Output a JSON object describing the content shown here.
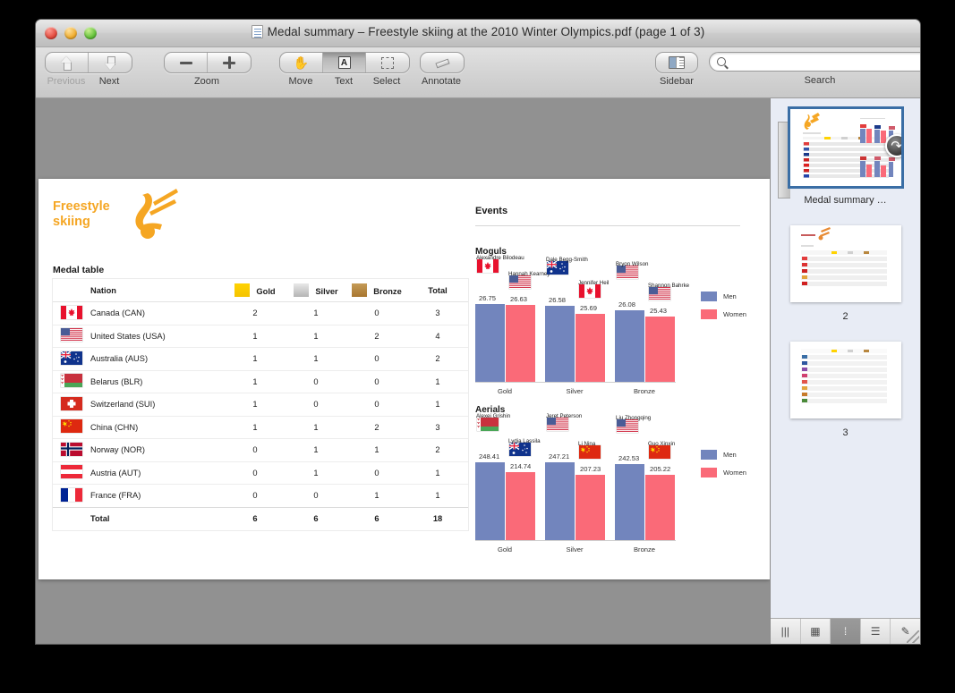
{
  "window": {
    "title": "Medal summary – Freestyle skiing at the 2010 Winter Olympics.pdf (page 1 of 3)",
    "doc_icon": "pdf-document-icon"
  },
  "toolbar": {
    "nav": {
      "previous": "Previous",
      "next": "Next"
    },
    "zoom": {
      "label": "Zoom",
      "out_icon": "zoom-out-icon",
      "in_icon": "zoom-in-icon"
    },
    "tools": {
      "move": "Move",
      "text": "Text",
      "select": "Select",
      "active": "Text"
    },
    "annotate": "Annotate",
    "sidebar": "Sidebar",
    "search": {
      "label": "Search",
      "value": "",
      "placeholder": ""
    }
  },
  "sidebar": {
    "thumbnails": [
      {
        "caption": "Medal summary …",
        "selected": true
      },
      {
        "caption": "2",
        "selected": false
      },
      {
        "caption": "3",
        "selected": false
      }
    ],
    "view_buttons": [
      "column-view-icon",
      "grid-view-icon",
      "thumbnail-view-icon",
      "outline-view-icon",
      "annotation-view-icon"
    ],
    "active_view": "thumbnail-view-icon"
  },
  "page": {
    "logo": {
      "line1": "Freestyle",
      "line2": "skiing",
      "color": "#f5a623"
    },
    "medal_table": {
      "title": "Medal table",
      "headers": [
        "",
        "Nation",
        "Gold",
        "Silver",
        "Bronze",
        "Total"
      ],
      "swatch_colors": {
        "gold": "#ffd301",
        "silver": "#d0d0d0",
        "bronze": "#b8873f"
      },
      "rows": [
        {
          "flag": "flag-canada",
          "nation": "Canada (CAN)",
          "gold": "2",
          "silver": "1",
          "bronze": "0",
          "total": "3"
        },
        {
          "flag": "flag-usa",
          "nation": "United States (USA)",
          "gold": "1",
          "silver": "1",
          "bronze": "2",
          "total": "4"
        },
        {
          "flag": "flag-australia",
          "nation": "Australia (AUS)",
          "gold": "1",
          "silver": "1",
          "bronze": "0",
          "total": "2"
        },
        {
          "flag": "flag-belarus",
          "nation": "Belarus (BLR)",
          "gold": "1",
          "silver": "0",
          "bronze": "0",
          "total": "1"
        },
        {
          "flag": "flag-switzerland",
          "nation": "Switzerland (SUI)",
          "gold": "1",
          "silver": "0",
          "bronze": "0",
          "total": "1"
        },
        {
          "flag": "flag-china",
          "nation": "China (CHN)",
          "gold": "1",
          "silver": "1",
          "bronze": "2",
          "total": "3"
        },
        {
          "flag": "flag-norway",
          "nation": "Norway (NOR)",
          "gold": "0",
          "silver": "1",
          "bronze": "1",
          "total": "2"
        },
        {
          "flag": "flag-austria",
          "nation": "Austria (AUT)",
          "gold": "0",
          "silver": "1",
          "bronze": "0",
          "total": "1"
        },
        {
          "flag": "flag-france",
          "nation": "France (FRA)",
          "gold": "0",
          "silver": "0",
          "bronze": "1",
          "total": "1"
        }
      ],
      "total_row": {
        "label": "Total",
        "gold": "6",
        "silver": "6",
        "bronze": "6",
        "total": "18"
      }
    },
    "events": {
      "title": "Events"
    }
  },
  "chart_data": [
    {
      "type": "bar",
      "title": "Moguls",
      "categories": [
        "Gold",
        "Silver",
        "Bronze"
      ],
      "series": [
        {
          "name": "Men",
          "color": "#7285bd",
          "values": [
            26.75,
            26.58,
            26.08
          ],
          "athletes": [
            "Alexandre Bilodeau",
            "Dale Begg-Smith",
            "Bryon Wilson"
          ],
          "flags": [
            "flag-canada",
            "flag-australia",
            "flag-usa"
          ]
        },
        {
          "name": "Women",
          "color": "#fa6a78",
          "values": [
            26.63,
            25.69,
            25.43
          ],
          "athletes": [
            "Hannah Kearney",
            "Jennifer Heil",
            "Shannon Bahrke"
          ],
          "flags": [
            "flag-usa",
            "flag-canada",
            "flag-usa"
          ]
        }
      ],
      "xlabel": "",
      "ylabel": "",
      "grid": false,
      "legend_position": "right"
    },
    {
      "type": "bar",
      "title": "Aerials",
      "categories": [
        "Gold",
        "Silver",
        "Bronze"
      ],
      "series": [
        {
          "name": "Men",
          "color": "#7285bd",
          "values": [
            248.41,
            247.21,
            242.53
          ],
          "athletes": [
            "Alexei Grishin",
            "Jeret Peterson",
            "Liu Zhongqing"
          ],
          "flags": [
            "flag-belarus",
            "flag-usa",
            "flag-usa"
          ]
        },
        {
          "name": "Women",
          "color": "#fa6a78",
          "values": [
            214.74,
            207.23,
            205.22
          ],
          "athletes": [
            "Lydia Lassila",
            "Li Nina",
            "Guo Xinxin"
          ],
          "flags": [
            "flag-australia",
            "flag-china",
            "flag-china"
          ]
        }
      ],
      "xlabel": "",
      "ylabel": "",
      "grid": false,
      "legend_position": "right"
    }
  ]
}
